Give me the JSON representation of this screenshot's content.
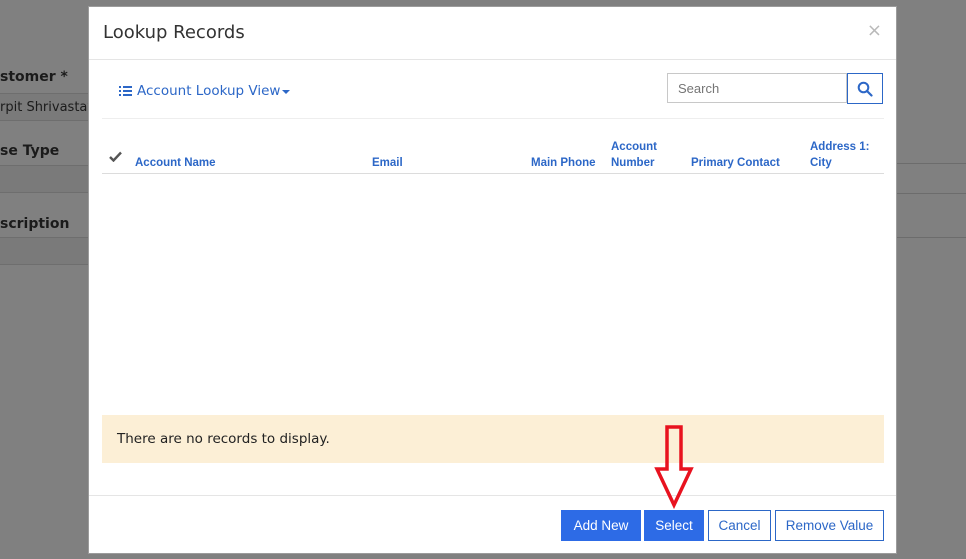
{
  "background": {
    "customer_label": "stomer",
    "required_mark": "*",
    "customer_value": "rpit Shrivastava",
    "case_type_label": "se Type",
    "description_label": "scription"
  },
  "modal": {
    "title": "Lookup Records",
    "close_glyph": "×",
    "view_selector_label": "Account Lookup View",
    "search": {
      "placeholder": "Search",
      "value": ""
    },
    "columns": [
      {
        "line1": "Account Name",
        "line2": ""
      },
      {
        "line1": "Email",
        "line2": ""
      },
      {
        "line1": "Main Phone",
        "line2": ""
      },
      {
        "line1": "Account",
        "line2": "Number"
      },
      {
        "line1": "Primary Contact",
        "line2": ""
      },
      {
        "line1": "Address 1:",
        "line2": "City"
      }
    ],
    "empty_message": "There are no records to display.",
    "buttons": {
      "add_new": "Add New",
      "select": "Select",
      "cancel": "Cancel",
      "remove_value": "Remove Value"
    }
  },
  "colors": {
    "accent": "#2c67c7",
    "primary_button": "#2d6be6",
    "empty_banner": "#fcefd6",
    "annotation_arrow": "#e8121f"
  },
  "icons": [
    "list-icon",
    "caret-down-icon",
    "search-icon",
    "check-icon",
    "close-icon",
    "annotation-arrow-icon"
  ]
}
